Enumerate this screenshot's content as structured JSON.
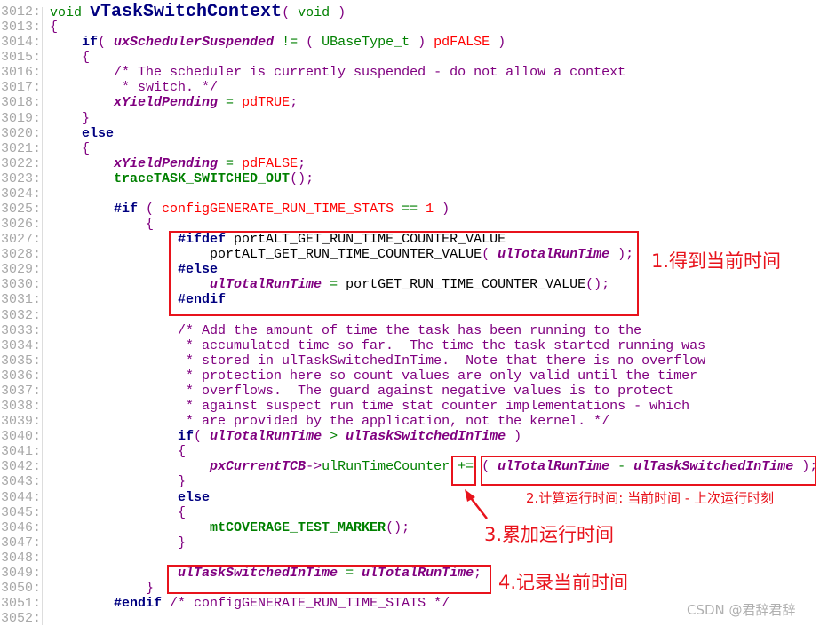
{
  "colors": {
    "keyword": "#000080",
    "variable": "#800080",
    "comment": "#800080",
    "text": "#008000",
    "constant": "#ff0000",
    "annotation": "#e8131c"
  },
  "lines": [
    {
      "num": "3012:",
      "tokens": [
        [
          "n",
          "void "
        ],
        [
          "f",
          "vTaskSwitchContext"
        ],
        [
          "p",
          "( "
        ],
        [
          "n",
          "void "
        ],
        [
          "p",
          ")"
        ]
      ]
    },
    {
      "num": "3013:",
      "tokens": [
        [
          "p",
          "{"
        ]
      ]
    },
    {
      "num": "3014:",
      "tokens": [
        [
          "n",
          "    "
        ],
        [
          "k",
          "if"
        ],
        [
          "p",
          "( "
        ],
        [
          "v",
          "uxSchedulerSuspended"
        ],
        [
          "n",
          " != "
        ],
        [
          "p",
          "( "
        ],
        [
          "n",
          "UBaseType_t "
        ],
        [
          "p",
          ") "
        ],
        [
          "r",
          "pdFALSE "
        ],
        [
          "p",
          ")"
        ]
      ]
    },
    {
      "num": "3015:",
      "tokens": [
        [
          "p",
          "    {"
        ]
      ]
    },
    {
      "num": "3016:",
      "tokens": [
        [
          "c",
          "        /* The scheduler is currently suspended - do not allow a context"
        ]
      ]
    },
    {
      "num": "3017:",
      "tokens": [
        [
          "c",
          "         * switch. */"
        ]
      ]
    },
    {
      "num": "3018:",
      "tokens": [
        [
          "n",
          "        "
        ],
        [
          "v",
          "xYieldPending"
        ],
        [
          "n",
          " = "
        ],
        [
          "r",
          "pdTRUE"
        ],
        [
          "p",
          ";"
        ]
      ]
    },
    {
      "num": "3019:",
      "tokens": [
        [
          "p",
          "    }"
        ]
      ]
    },
    {
      "num": "3020:",
      "tokens": [
        [
          "n",
          "    "
        ],
        [
          "k",
          "else"
        ]
      ]
    },
    {
      "num": "3021:",
      "tokens": [
        [
          "p",
          "    {"
        ]
      ]
    },
    {
      "num": "3022:",
      "tokens": [
        [
          "n",
          "        "
        ],
        [
          "v",
          "xYieldPending"
        ],
        [
          "n",
          " = "
        ],
        [
          "r",
          "pdFALSE"
        ],
        [
          "p",
          ";"
        ]
      ]
    },
    {
      "num": "3023:",
      "tokens": [
        [
          "n",
          "        "
        ],
        [
          "m",
          "traceTASK_SWITCHED_OUT"
        ],
        [
          "p",
          "();"
        ]
      ]
    },
    {
      "num": "3024:",
      "tokens": []
    },
    {
      "num": "3025:",
      "tokens": [
        [
          "n",
          "        "
        ],
        [
          "k",
          "#if "
        ],
        [
          "p",
          "( "
        ],
        [
          "r",
          "configGENERATE_RUN_TIME_STATS "
        ],
        [
          "n",
          "== "
        ],
        [
          "r",
          "1 "
        ],
        [
          "p",
          ")"
        ]
      ]
    },
    {
      "num": "3026:",
      "tokens": [
        [
          "p",
          "            {"
        ]
      ]
    },
    {
      "num": "3027:",
      "tokens": [
        [
          "n",
          "                "
        ],
        [
          "k",
          "#ifdef "
        ],
        [
          "d",
          "portALT_GET_RUN_TIME_COUNTER_VALUE"
        ]
      ]
    },
    {
      "num": "3028:",
      "tokens": [
        [
          "n",
          "                    "
        ],
        [
          "d",
          "portALT_GET_RUN_TIME_COUNTER_VALUE"
        ],
        [
          "p",
          "( "
        ],
        [
          "v",
          "ulTotalRunTime"
        ],
        [
          "p",
          " );"
        ]
      ]
    },
    {
      "num": "3029:",
      "tokens": [
        [
          "n",
          "                "
        ],
        [
          "k",
          "#else"
        ]
      ]
    },
    {
      "num": "3030:",
      "tokens": [
        [
          "n",
          "                    "
        ],
        [
          "v",
          "ulTotalRunTime"
        ],
        [
          "n",
          " = "
        ],
        [
          "d",
          "portGET_RUN_TIME_COUNTER_VALUE"
        ],
        [
          "p",
          "();"
        ]
      ]
    },
    {
      "num": "3031:",
      "tokens": [
        [
          "n",
          "                "
        ],
        [
          "k",
          "#endif"
        ]
      ]
    },
    {
      "num": "3032:",
      "tokens": []
    },
    {
      "num": "3033:",
      "tokens": [
        [
          "c",
          "                /* Add the amount of time the task has been running to the"
        ]
      ]
    },
    {
      "num": "3034:",
      "tokens": [
        [
          "c",
          "                 * accumulated time so far.  The time the task started running was"
        ]
      ]
    },
    {
      "num": "3035:",
      "tokens": [
        [
          "c",
          "                 * stored in ulTaskSwitchedInTime.  Note that there is no overflow"
        ]
      ]
    },
    {
      "num": "3036:",
      "tokens": [
        [
          "c",
          "                 * protection here so count values are only valid until the timer"
        ]
      ]
    },
    {
      "num": "3037:",
      "tokens": [
        [
          "c",
          "                 * overflows.  The guard against negative values is to protect"
        ]
      ]
    },
    {
      "num": "3038:",
      "tokens": [
        [
          "c",
          "                 * against suspect run time stat counter implementations - which"
        ]
      ]
    },
    {
      "num": "3039:",
      "tokens": [
        [
          "c",
          "                 * are provided by the application, not the kernel. */"
        ]
      ]
    },
    {
      "num": "3040:",
      "tokens": [
        [
          "n",
          "                "
        ],
        [
          "k",
          "if"
        ],
        [
          "p",
          "( "
        ],
        [
          "v",
          "ulTotalRunTime"
        ],
        [
          "n",
          " > "
        ],
        [
          "v",
          "ulTaskSwitchedInTime"
        ],
        [
          "p",
          " )"
        ]
      ]
    },
    {
      "num": "3041:",
      "tokens": [
        [
          "p",
          "                {"
        ]
      ]
    },
    {
      "num": "3042:",
      "tokens": [
        [
          "n",
          "                    "
        ],
        [
          "v",
          "pxCurrentTCB"
        ],
        [
          "p",
          "->"
        ],
        [
          "n",
          "ulRunTimeCounter "
        ],
        [
          "n",
          "+= "
        ],
        [
          "p",
          "( "
        ],
        [
          "v",
          "ulTotalRunTime"
        ],
        [
          "n",
          " - "
        ],
        [
          "v",
          "ulTaskSwitchedInTime"
        ],
        [
          "p",
          " );"
        ]
      ]
    },
    {
      "num": "3043:",
      "tokens": [
        [
          "p",
          "                }"
        ]
      ]
    },
    {
      "num": "3044:",
      "tokens": [
        [
          "n",
          "                "
        ],
        [
          "k",
          "else"
        ]
      ]
    },
    {
      "num": "3045:",
      "tokens": [
        [
          "p",
          "                {"
        ]
      ]
    },
    {
      "num": "3046:",
      "tokens": [
        [
          "n",
          "                    "
        ],
        [
          "m",
          "mtCOVERAGE_TEST_MARKER"
        ],
        [
          "p",
          "();"
        ]
      ]
    },
    {
      "num": "3047:",
      "tokens": [
        [
          "p",
          "                }"
        ]
      ]
    },
    {
      "num": "3048:",
      "tokens": []
    },
    {
      "num": "3049:",
      "tokens": [
        [
          "n",
          "                "
        ],
        [
          "v",
          "ulTaskSwitchedInTime"
        ],
        [
          "n",
          " = "
        ],
        [
          "v",
          "ulTotalRunTime"
        ],
        [
          "p",
          ";"
        ]
      ]
    },
    {
      "num": "3050:",
      "tokens": [
        [
          "p",
          "            }"
        ]
      ]
    },
    {
      "num": "3051:",
      "tokens": [
        [
          "n",
          "        "
        ],
        [
          "k",
          "#endif "
        ],
        [
          "c",
          "/* configGENERATE_RUN_TIME_STATS */"
        ]
      ]
    },
    {
      "num": "3052:",
      "tokens": []
    }
  ],
  "annotations": {
    "a1": "1.得到当前时间",
    "a2": "2.计算运行时间: 当前时间 - 上次运行时刻",
    "a3": "3.累加运行时间",
    "a4": "4.记录当前时间"
  },
  "watermark": "CSDN @君辞君辞"
}
